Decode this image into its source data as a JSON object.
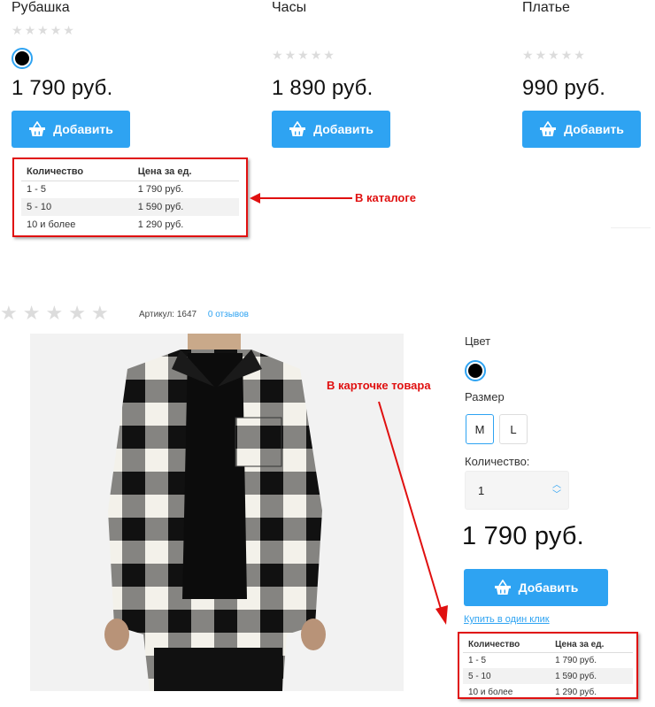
{
  "catalog": {
    "cards": [
      {
        "title": "Рубашка",
        "price": "1 790 руб.",
        "add_label": "Добавить"
      },
      {
        "title": "Часы",
        "price": "1 890 руб.",
        "add_label": "Добавить"
      },
      {
        "title": "Платье",
        "price": "990 руб.",
        "add_label": "Добавить"
      }
    ],
    "tiers": {
      "headers": [
        "Количество",
        "Цена за ед."
      ],
      "rows": [
        [
          "1 - 5",
          "1 790 руб."
        ],
        [
          "5 - 10",
          "1 590 руб."
        ],
        [
          "10 и более",
          "1 290 руб."
        ]
      ]
    },
    "annotation": "В каталоге"
  },
  "product": {
    "article_label": "Артикул:",
    "article_value": "1647",
    "reviews_link": "0 отзывов",
    "color_label": "Цвет",
    "size_label": "Размер",
    "sizes": [
      "M",
      "L"
    ],
    "qty_label": "Количество:",
    "qty_value": "1",
    "price": "1 790 руб.",
    "add_label": "Добавить",
    "one_click": "Купить в один клик",
    "annotation": "В карточке товара",
    "tiers": {
      "headers": [
        "Количество",
        "Цена за ед."
      ],
      "rows": [
        [
          "1 - 5",
          "1 790 руб."
        ],
        [
          "5 - 10",
          "1 590 руб."
        ],
        [
          "10 и более",
          "1 290 руб."
        ]
      ]
    }
  },
  "colors": {
    "accent": "#2ea3f2",
    "annotation": "#e01010",
    "swatch": "#000000"
  },
  "icons": [
    "star-icon",
    "basket-icon",
    "arrow-icon",
    "chevron-up-icon",
    "chevron-down-icon"
  ]
}
